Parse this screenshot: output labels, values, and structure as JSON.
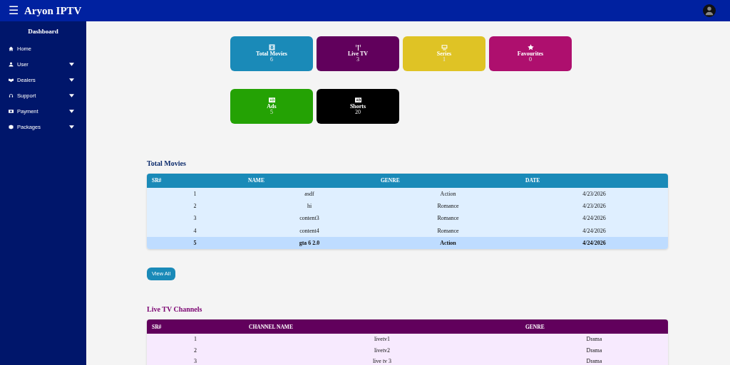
{
  "app": {
    "menu_icon": "☰",
    "title": "Aryon IPTV"
  },
  "sidebar": {
    "title": "Dashboard",
    "items": [
      {
        "label": "Home",
        "has_submenu": false
      },
      {
        "label": "User",
        "has_submenu": true
      },
      {
        "label": "Dealers",
        "has_submenu": true
      },
      {
        "label": "Support",
        "has_submenu": true
      },
      {
        "label": "Payment",
        "has_submenu": true
      },
      {
        "label": "Packages",
        "has_submenu": true
      }
    ]
  },
  "stats": [
    {
      "label": "Total Movies",
      "count": "6",
      "color": "#1a8ab8"
    },
    {
      "label": "Live TV",
      "count": "3",
      "color": "#61005c"
    },
    {
      "label": "Series",
      "count": "1",
      "color": "#dfc325"
    },
    {
      "label": "Favourites",
      "count": "0",
      "color": "#ae0f6e"
    },
    {
      "label": "Ads",
      "count": "5",
      "color": "#24a204"
    },
    {
      "label": "Shorts",
      "count": "20",
      "color": "#000000"
    }
  ],
  "movies_table": {
    "title": "Total Movies",
    "columns": [
      "SR#",
      "NAME",
      "GENRE",
      "DATE"
    ],
    "rows": [
      {
        "cells": [
          "1",
          "asdf",
          "Action",
          "4/23/2026"
        ],
        "selected": false
      },
      {
        "cells": [
          "2",
          "hi",
          "Romance",
          "4/23/2026"
        ],
        "selected": false
      },
      {
        "cells": [
          "3",
          "content3",
          "Romance",
          "4/24/2026"
        ],
        "selected": false
      },
      {
        "cells": [
          "4",
          "content4",
          "Romance",
          "4/24/2026"
        ],
        "selected": false
      },
      {
        "cells": [
          "5",
          "gta 6 2.0",
          "Action",
          "4/24/2026"
        ],
        "selected": true
      }
    ],
    "button": "View All"
  },
  "live_table": {
    "title": "Live TV Channels",
    "columns": [
      "SR#",
      "CHANNEL NAME",
      "GENRE"
    ],
    "rows": [
      {
        "cells": [
          "1",
          "livetv1",
          "Drama"
        ],
        "selected": false
      },
      {
        "cells": [
          "2",
          "livetv2",
          "Drama"
        ],
        "selected": false
      },
      {
        "cells": [
          "3",
          "live tv 3",
          "Drama"
        ],
        "selected": false
      }
    ]
  }
}
